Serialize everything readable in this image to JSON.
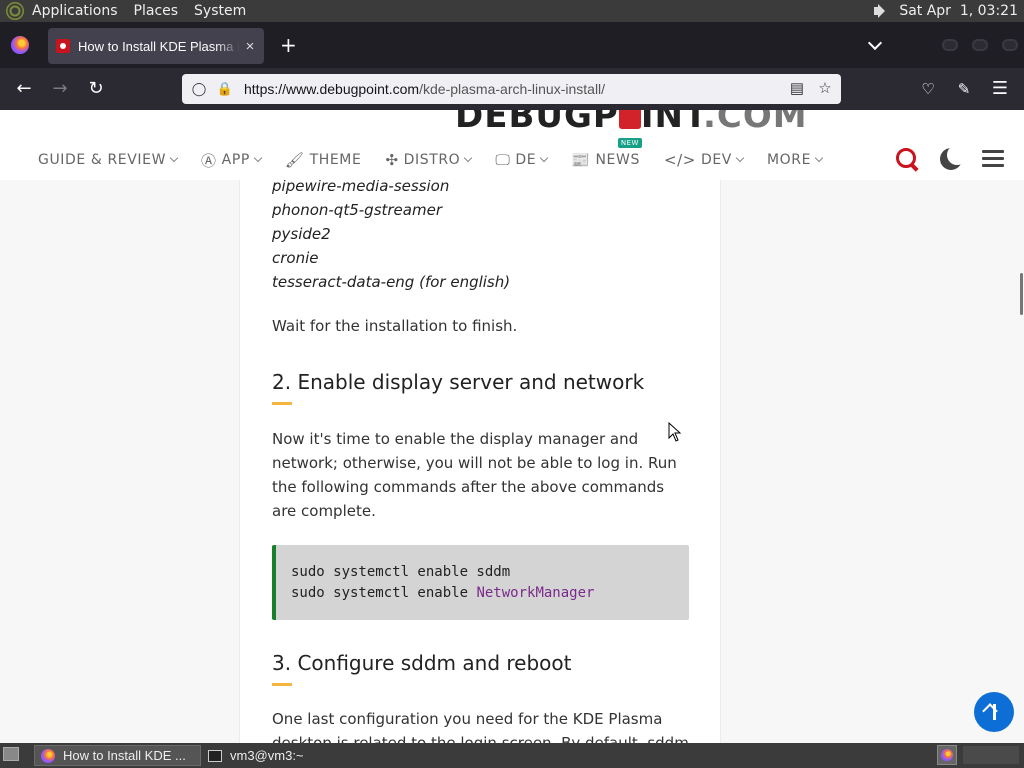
{
  "top_panel": {
    "menus": [
      "Applications",
      "Places",
      "System"
    ],
    "clock": "Sat Apr  1, 03:21"
  },
  "browser": {
    "tab": {
      "title": "How to Install KDE Plasma in Arch Linux",
      "close": "×"
    },
    "new_tab": "+",
    "url": {
      "domain": "https://www.debugpoint.com",
      "path": "/kde-plasma-arch-linux-install/"
    }
  },
  "site": {
    "logo": {
      "part1": "DEBUGP",
      "part2": "INT",
      "part3": ".COM"
    },
    "menu": [
      {
        "label": "GUIDE & REVIEW",
        "icon": "",
        "dropdown": true
      },
      {
        "label": "APP",
        "icon": "app-store-icon",
        "glyph": "Ⓐ",
        "dropdown": true
      },
      {
        "label": "THEME",
        "icon": "brush-icon",
        "glyph": "🖌",
        "dropdown": false
      },
      {
        "label": "DISTRO",
        "icon": "distro-icon",
        "glyph": "✣",
        "dropdown": true
      },
      {
        "label": "DE",
        "icon": "desktop-icon",
        "glyph": "🖵",
        "dropdown": true
      },
      {
        "label": "NEWS",
        "icon": "newspaper-icon",
        "glyph": "📰",
        "dropdown": false,
        "badge": "NEW"
      },
      {
        "label": "DEV",
        "icon": "code-icon",
        "glyph": "</>",
        "dropdown": true
      },
      {
        "label": "MORE",
        "icon": "",
        "dropdown": true
      }
    ]
  },
  "article": {
    "packages": [
      "pipewire-media-session",
      "phonon-qt5-gstreamer",
      "pyside2",
      "cronie",
      "tesseract-data-eng (for english)"
    ],
    "wait_text": "Wait for the installation to finish.",
    "section2": {
      "heading": "2. Enable display server and network",
      "body": "Now it's time to enable the display manager and network; otherwise, you will not be able to log in. Run the following commands after the above commands are complete.",
      "code_line1": "sudo systemctl enable sddm",
      "code_line2_prefix": "sudo systemctl enable ",
      "code_line2_kw": "NetworkManager"
    },
    "section3": {
      "heading": "3. Configure sddm and reboot",
      "body": "One last configuration you need for the KDE Plasma desktop is related to the login screen. By default, sddm"
    }
  },
  "taskbar": {
    "tasks": [
      {
        "label": "How to Install KDE ...",
        "icon": "firefox-icon"
      },
      {
        "label": "vm3@vm3:~",
        "icon": "terminal-icon"
      }
    ]
  },
  "colors": {
    "accent_red": "#c9131e",
    "heading_underline": "#f4b63f",
    "code_border": "#1a7f2a",
    "back_to_top": "#0d6fd6"
  }
}
